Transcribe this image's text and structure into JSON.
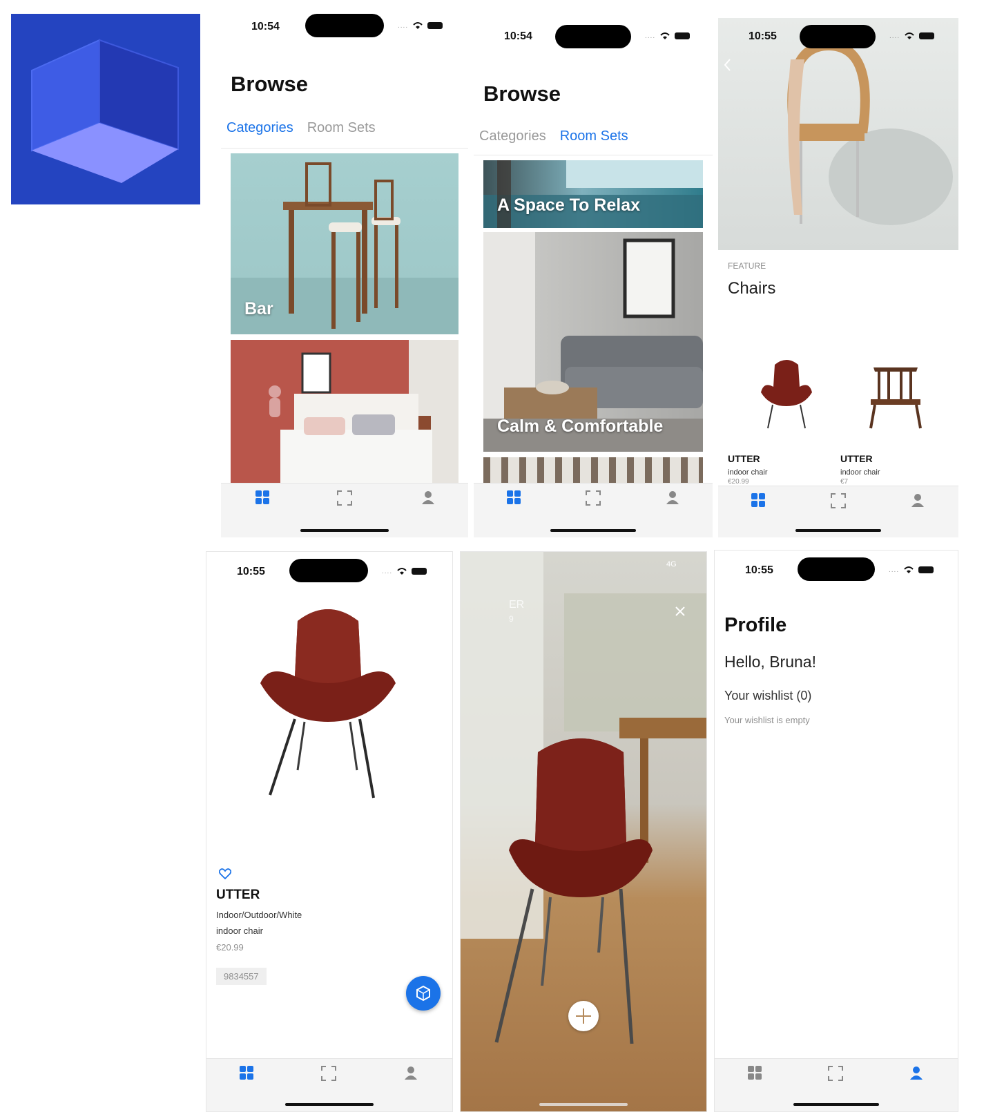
{
  "browse_categories": {
    "time": "10:54",
    "title": "Browse",
    "tabs": [
      "Categories",
      "Room Sets"
    ],
    "cards": [
      {
        "label": "Bar"
      },
      {
        "label": ""
      }
    ]
  },
  "browse_roomsets": {
    "time": "10:54",
    "title": "Browse",
    "tabs": [
      "Categories",
      "Room Sets"
    ],
    "cards": [
      {
        "label": "A Space To Relax"
      },
      {
        "label": "Calm & Comfortable"
      }
    ]
  },
  "chairs_feature": {
    "time": "10:55",
    "overline": "FEATURE",
    "title": "Chairs",
    "products": [
      {
        "name": "UTTER",
        "type": "indoor chair",
        "price": "€20.99"
      },
      {
        "name": "UTTER",
        "type": "indoor chair",
        "price": "€7"
      }
    ]
  },
  "product_detail": {
    "time": "10:55",
    "name": "UTTER",
    "subtitle": "Indoor/Outdoor/White",
    "type": "indoor chair",
    "price": "€20.99",
    "sku": "9834557"
  },
  "ar_view": {
    "network": "4G",
    "overlay_name": "ER",
    "overlay_price": "9"
  },
  "profile": {
    "time": "10:55",
    "title": "Profile",
    "greeting": "Hello, Bruna!",
    "wishlist_title": "Your wishlist (0)",
    "wishlist_empty": "Your wishlist is empty"
  },
  "colors": {
    "accent": "#1b73e8",
    "logo_bg": "#2444c0",
    "chair_red": "#7a2018"
  },
  "icons": [
    "app-logo-icon",
    "grid-icon",
    "ar-scan-icon",
    "profile-icon",
    "heart-icon",
    "back-chevron-icon",
    "close-icon",
    "plus-icon",
    "wifi-icon",
    "battery-icon"
  ]
}
